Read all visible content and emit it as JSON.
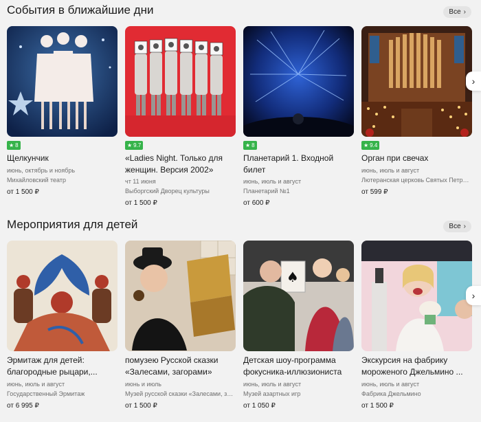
{
  "sections": [
    {
      "title": "События в ближайшие дни",
      "all_label": "Все",
      "cards": [
        {
          "rating": "8",
          "title_lines": [
            "Щелкунчик"
          ],
          "meta1": "июнь, октябрь и ноябрь",
          "meta2": "Михайловский театр",
          "price": "от 1 500 ₽"
        },
        {
          "rating": "9.7",
          "title_lines": [
            "«Ladies Night. Только для",
            "женщин. Версия 2002»"
          ],
          "meta1": "чт 11 июня",
          "meta2": "Выборгский Дворец культуры",
          "price": "от 1 500 ₽"
        },
        {
          "rating": "8",
          "title_lines": [
            "Планетарий 1. Входной",
            "билет"
          ],
          "meta1": "июнь, июль и август",
          "meta2": "Планетарий №1",
          "price": "от 600 ₽"
        },
        {
          "rating": "9.4",
          "title_lines": [
            "Орган при свечах"
          ],
          "meta1": "июнь, июль и август",
          "meta2": "Лютеранская церковь Святых Петра и Павла",
          "price": "от 599 ₽"
        }
      ]
    },
    {
      "title": "Мероприятия для детей",
      "all_label": "Все",
      "cards": [
        {
          "title_lines": [
            "Эрмитаж для детей:",
            "благородные рыцари,..."
          ],
          "meta1": "июнь, июль и август",
          "meta2": "Государственный Эрмитаж",
          "price": "от 6 995 ₽"
        },
        {
          "title_lines": [
            "помузею Русской сказки",
            "«Залесами, загорами»"
          ],
          "meta1": "июнь и июль",
          "meta2": "Музей русской сказки «Залесами, загорами»",
          "price": "от 1 500 ₽"
        },
        {
          "title_lines": [
            "Детская шоу-программа",
            "фокусника-иллюзиониста"
          ],
          "meta1": "июнь, июль и август",
          "meta2": "Музей азартных игр",
          "price": "от 1 050 ₽"
        },
        {
          "title_lines": [
            "Экскурсия на фабрику",
            "мороженого Джельмино ..."
          ],
          "meta1": "июнь, июль и август",
          "meta2": "Фабрика Джельмино",
          "price": "от 1 500 ₽"
        }
      ]
    }
  ],
  "icons": {
    "next": "chevron-right-icon",
    "star": "star-icon"
  },
  "colors": {
    "rating_bg": "#36b34a",
    "background": "#f2f2f2"
  }
}
